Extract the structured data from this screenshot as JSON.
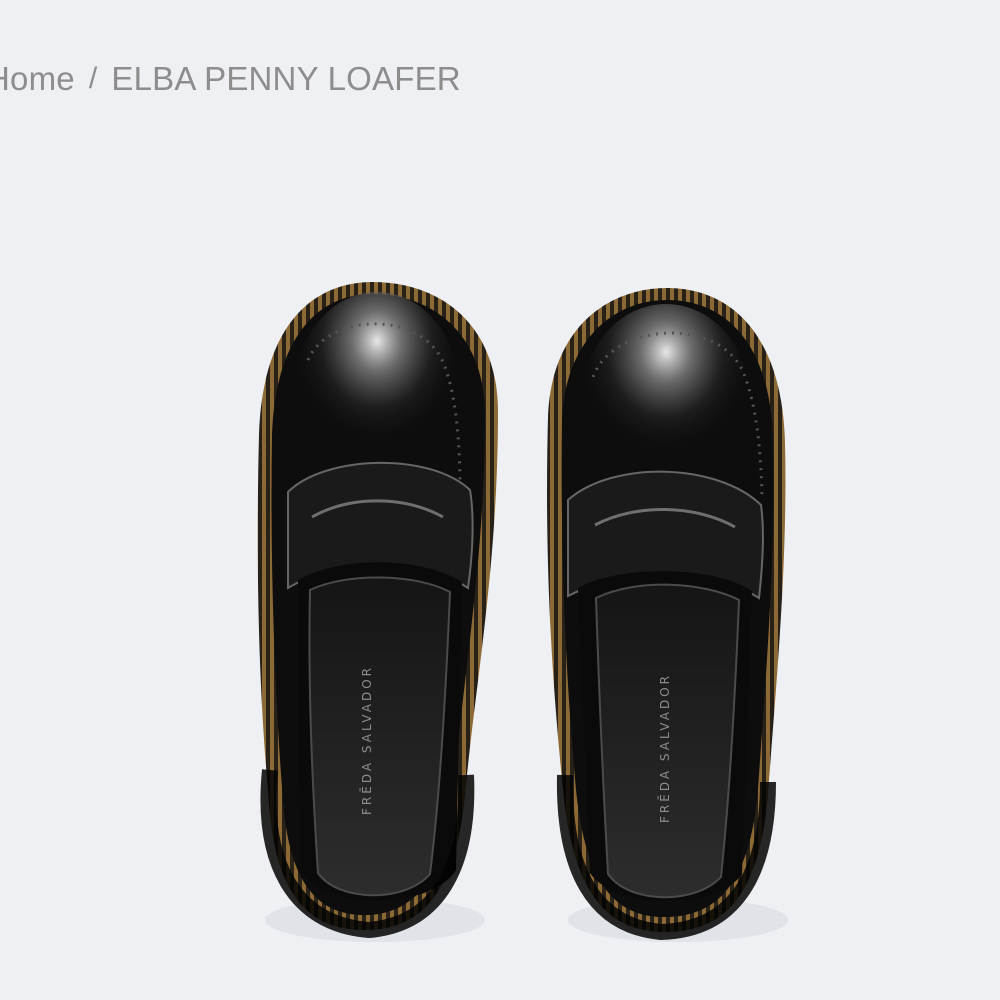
{
  "breadcrumb": {
    "home_label": "Home",
    "separator": "/",
    "current_label": "ELBA PENNY LOAFER"
  },
  "product": {
    "insole_brand": "FRĒDA SALVADOR"
  },
  "colors": {
    "background": "#eef0f3",
    "breadcrumb_text": "#8d8d8d",
    "leather": "#111111"
  }
}
